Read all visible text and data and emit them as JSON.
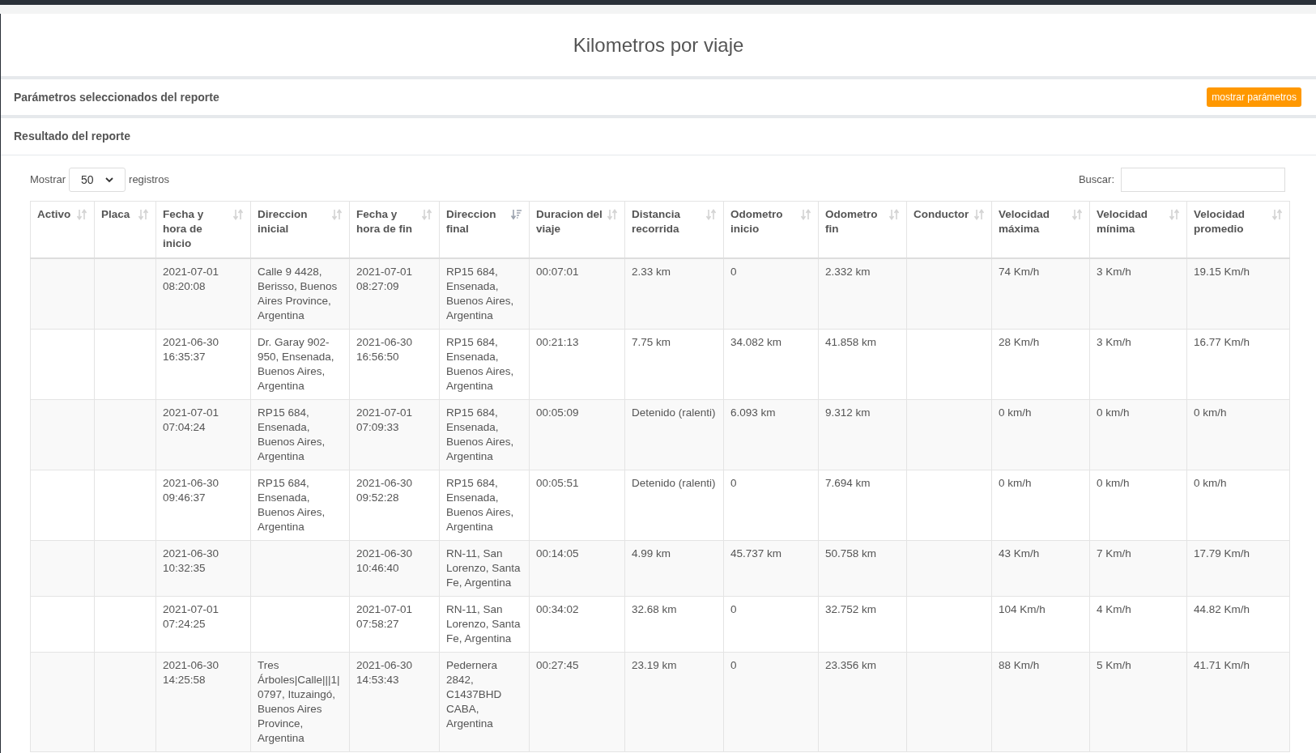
{
  "page_title": "Kilometros por viaje",
  "parameters_section": {
    "title": "Parámetros seleccionados del reporte",
    "button": "mostrar parámetros"
  },
  "result_section": {
    "title": "Resultado del reporte"
  },
  "length_control": {
    "prefix": "Mostrar",
    "value": "50",
    "suffix": "registros"
  },
  "search": {
    "label": "Buscar:"
  },
  "table": {
    "columns": [
      {
        "label": "Activo",
        "sorted": false
      },
      {
        "label": "Placa",
        "sorted": false
      },
      {
        "label": "Fecha y hora de inicio",
        "sorted": false
      },
      {
        "label": "Direccion inicial",
        "sorted": false
      },
      {
        "label": "Fecha y hora de fin",
        "sorted": false
      },
      {
        "label": "Direccion final",
        "sorted": true
      },
      {
        "label": "Duracion del viaje",
        "sorted": false
      },
      {
        "label": "Distancia recorrida",
        "sorted": false
      },
      {
        "label": "Odometro inicio",
        "sorted": false
      },
      {
        "label": "Odometro fin",
        "sorted": false
      },
      {
        "label": "Conductor",
        "sorted": false
      },
      {
        "label": "Velocidad máxima",
        "sorted": false
      },
      {
        "label": "Velocidad mínima",
        "sorted": false
      },
      {
        "label": "Velocidad promedio",
        "sorted": false
      }
    ],
    "rows": [
      {
        "cells": [
          null,
          null,
          "2021-07-01 08:20:08",
          "Calle 9 4428, Berisso, Buenos Aires Province, Argentina",
          "2021-07-01 08:27:09",
          "RP15 684, Ensenada, Buenos Aires, Argentina",
          "00:07:01",
          "2.33 km",
          "0",
          "2.332 km",
          null,
          "74 Km/h",
          "3 Km/h",
          "19.15 Km/h"
        ]
      },
      {
        "cells": [
          null,
          null,
          "2021-06-30 16:35:37",
          "Dr. Garay 902-950, Ensenada, Buenos Aires, Argentina",
          "2021-06-30 16:56:50",
          "RP15 684, Ensenada, Buenos Aires, Argentina",
          "00:21:13",
          "7.75 km",
          "34.082 km",
          "41.858 km",
          null,
          "28 Km/h",
          "3 Km/h",
          "16.77 Km/h"
        ]
      },
      {
        "cells": [
          null,
          null,
          "2021-07-01 07:04:24",
          "RP15 684, Ensenada, Buenos Aires, Argentina",
          "2021-07-01 07:09:33",
          "RP15 684, Ensenada, Buenos Aires, Argentina",
          "00:05:09",
          "Detenido (ralenti)",
          "6.093 km",
          "9.312 km",
          null,
          "0 km/h",
          "0 km/h",
          "0 km/h"
        ]
      },
      {
        "cells": [
          null,
          null,
          "2021-06-30 09:46:37",
          "RP15 684, Ensenada, Buenos Aires, Argentina",
          "2021-06-30 09:52:28",
          "RP15 684, Ensenada, Buenos Aires, Argentina",
          "00:05:51",
          "Detenido (ralenti)",
          "0",
          "7.694 km",
          null,
          "0 km/h",
          "0 km/h",
          "0 km/h"
        ]
      },
      {
        "cells": [
          null,
          null,
          "2021-06-30 10:32:35",
          null,
          "2021-06-30 10:46:40",
          "RN-11, San Lorenzo, Santa Fe, Argentina",
          "00:14:05",
          "4.99 km",
          "45.737 km",
          "50.758 km",
          null,
          "43 Km/h",
          "7 Km/h",
          "17.79 Km/h"
        ]
      },
      {
        "cells": [
          null,
          null,
          "2021-07-01 07:24:25",
          null,
          "2021-07-01 07:58:27",
          "RN-11, San Lorenzo, Santa Fe, Argentina",
          "00:34:02",
          "32.68 km",
          "0",
          "32.752 km",
          null,
          "104 Km/h",
          "4 Km/h",
          "44.82 Km/h"
        ]
      },
      {
        "cells": [
          null,
          null,
          "2021-06-30 14:25:58",
          "Tres Árboles|Calle|||1|0797, Ituzaingó, Buenos Aires Province, Argentina",
          "2021-06-30 14:53:43",
          "Pedernera 2842, C1437BHD CABA, Argentina",
          "00:27:45",
          "23.19 km",
          "0",
          "23.356 km",
          null,
          "88 Km/h",
          "5 Km/h",
          "41.71 Km/h"
        ]
      }
    ]
  }
}
